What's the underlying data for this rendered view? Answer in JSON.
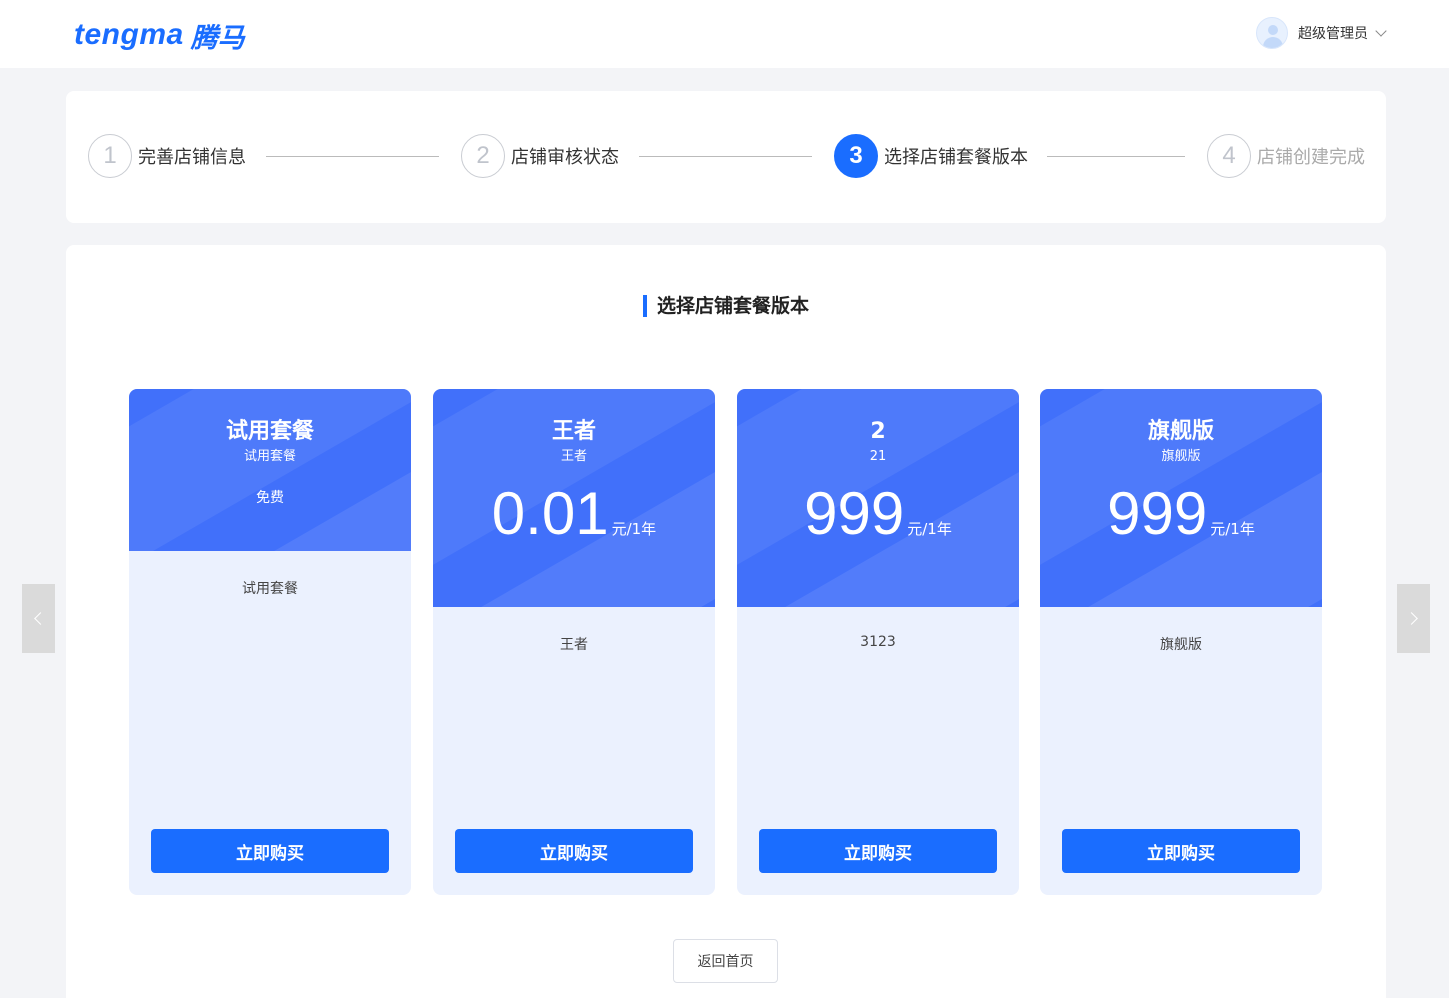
{
  "header": {
    "logo_en": "tengma",
    "logo_cn": "腾马",
    "user_name": "超级管理员"
  },
  "steps": [
    {
      "num": "1",
      "label": "完善店铺信息",
      "state": "done"
    },
    {
      "num": "2",
      "label": "店铺审核状态",
      "state": "done"
    },
    {
      "num": "3",
      "label": "选择店铺套餐版本",
      "state": "active"
    },
    {
      "num": "4",
      "label": "店铺创建完成",
      "state": "future"
    }
  ],
  "section_title": "选择店铺套餐版本",
  "plans": [
    {
      "name": "试用套餐",
      "subtitle": "试用套餐",
      "free_label": "免费",
      "description": "试用套餐",
      "button": "立即购买"
    },
    {
      "name": "王者",
      "subtitle": "王者",
      "price": "0.01",
      "unit": "元/1年",
      "description": "王者",
      "button": "立即购买"
    },
    {
      "name": "2",
      "subtitle": "21",
      "price": "999",
      "unit": "元/1年",
      "description": "3123",
      "button": "立即购买"
    },
    {
      "name": "旗舰版",
      "subtitle": "旗舰版",
      "price": "999",
      "unit": "元/1年",
      "description": "旗舰版",
      "button": "立即购买"
    }
  ],
  "back_button": "返回首页",
  "colors": {
    "accent": "#1a6dff",
    "plan_header": "#4170fa",
    "plan_body": "#ebf1fe"
  },
  "icons": {
    "prev": "chevron-left-icon",
    "next": "chevron-right-icon",
    "user_menu": "chevron-down-icon"
  }
}
